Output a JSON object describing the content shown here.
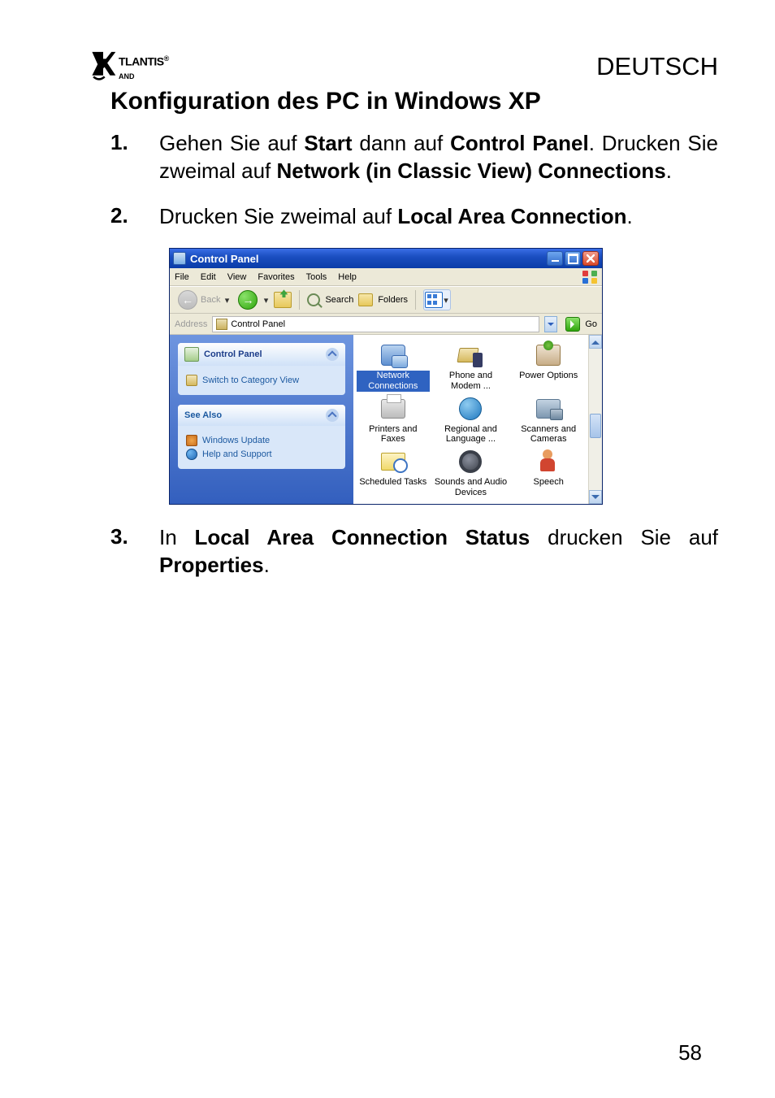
{
  "header": {
    "brand": "TLANTIS",
    "brand_sub": "AND",
    "brand_sup": "®",
    "language": "DEUTSCH"
  },
  "section_title": "Konfiguration des PC in Windows XP",
  "steps": [
    {
      "n": "1.",
      "pre1": "Gehen Sie auf ",
      "b1": "Start",
      "mid1": " dann auf ",
      "b2": "Control    Panel",
      "post1": ". Drucken Sie zweimal auf ",
      "b3": "Network (in Classic View) Connections",
      "post2": "."
    },
    {
      "n": "2.",
      "pre1": "Drucken Sie zweimal auf  ",
      "b1": "Local Area Connection",
      "post1": "."
    },
    {
      "n": "3.",
      "pre1": "In ",
      "b1": "Local Area Connection Status",
      "mid1": " drucken Sie auf ",
      "b2": "Properties",
      "post1": "."
    }
  ],
  "window": {
    "title": "Control Panel",
    "menu": [
      "File",
      "Edit",
      "View",
      "Favorites",
      "Tools",
      "Help"
    ],
    "toolbar": {
      "back": "Back",
      "search": "Search",
      "folders": "Folders"
    },
    "address": {
      "label": "Address",
      "value": "Control Panel",
      "go": "Go"
    },
    "side": {
      "panel1": {
        "title": "Control Panel",
        "link1": "Switch to Category View"
      },
      "panel2": {
        "title": "See Also",
        "link1": "Windows Update",
        "link2": "Help and Support"
      }
    },
    "items": [
      {
        "label": "Network Connections"
      },
      {
        "label": "Phone and Modem ..."
      },
      {
        "label": "Power Options"
      },
      {
        "label": "Printers and Faxes"
      },
      {
        "label": "Regional and Language ..."
      },
      {
        "label": "Scanners and Cameras"
      },
      {
        "label": "Scheduled Tasks"
      },
      {
        "label": "Sounds and Audio Devices"
      },
      {
        "label": "Speech"
      }
    ]
  },
  "page_number": "58"
}
